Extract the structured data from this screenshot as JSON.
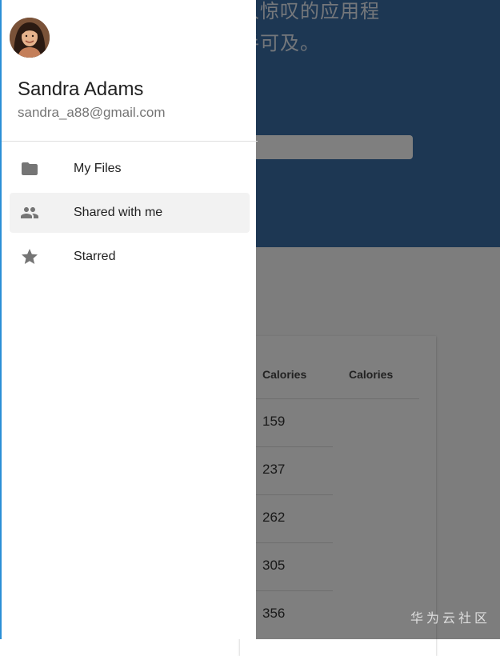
{
  "background": {
    "hero_line_1": "人惊叹的应用程",
    "hero_line_2": "手可及。",
    "table": {
      "headers": [
        "Calories",
        "Calories"
      ],
      "values": [
        "159",
        "237",
        "262",
        "305",
        "356"
      ]
    }
  },
  "drawer": {
    "user": {
      "name": "Sandra Adams",
      "email": "sandra_a88@gmail.com"
    },
    "items": [
      {
        "label": "My Files",
        "icon": "folder-icon"
      },
      {
        "label": "Shared with me",
        "icon": "people-icon",
        "active": true
      },
      {
        "label": "Starred",
        "icon": "star-icon"
      }
    ]
  },
  "watermark": "华为云社区",
  "colors": {
    "hero": "#3b6fa6",
    "drawer_border": "#2b8fd6",
    "icon": "#757575",
    "active_bg": "#f2f2f2"
  }
}
